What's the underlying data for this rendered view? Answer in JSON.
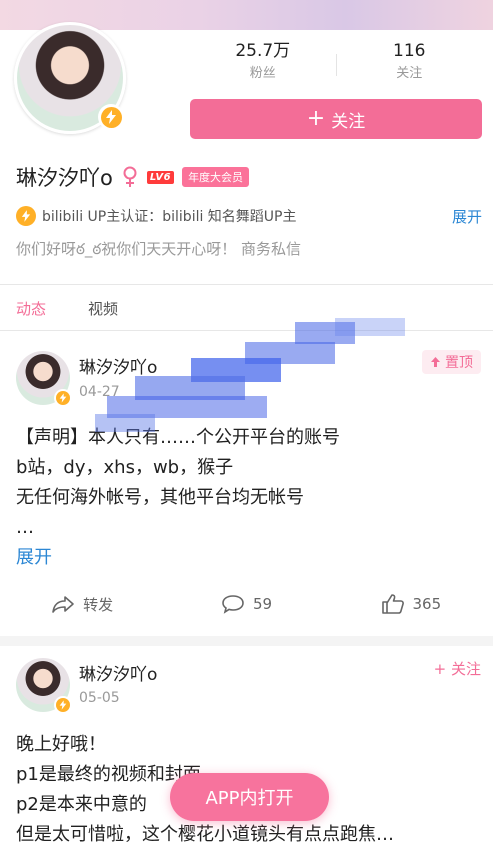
{
  "profile": {
    "followers_count": "25.7万",
    "followers_label": "粉丝",
    "following_count": "116",
    "following_label": "关注",
    "follow_button": "关注",
    "name": "琳汐汐吖o",
    "level_badge": "LV6",
    "vip_badge": "年度大会员",
    "auth_text": "bilibili UP主认证：bilibili 知名舞蹈UP主",
    "expand": "展开",
    "signature": "你们好呀ఠ_ఠ祝你们天天开心呀！  商务私信"
  },
  "tabs": [
    {
      "label": "动态",
      "active": true
    },
    {
      "label": "视频",
      "active": false
    }
  ],
  "posts": [
    {
      "author": "琳汐汐吖o",
      "date": "04-27",
      "pin_label": "置顶",
      "lines": [
        "【声明】本人只有……个公开平台的账号",
        "b站，dy，xhs，wb，猴子",
        "无任何海外帐号，其他平台均无帐号",
        "…"
      ],
      "expand": "展开",
      "repost_label": "转发",
      "comments": "59",
      "likes": "365"
    },
    {
      "author": "琳汐汐吖o",
      "date": "05-05",
      "follow_label": "+ 关注",
      "lines": [
        "晚上好哦！",
        "p1是最终的视频和封面",
        "p2是本来中意的",
        "但是太可惜啦，这个樱花小道镜头有点点跑焦…"
      ]
    }
  ],
  "app_open_button": "APP内打开",
  "colors": {
    "accent_pink": "#f36d97",
    "link_blue": "#2c87d4",
    "badge_gold": "#ffb027"
  }
}
